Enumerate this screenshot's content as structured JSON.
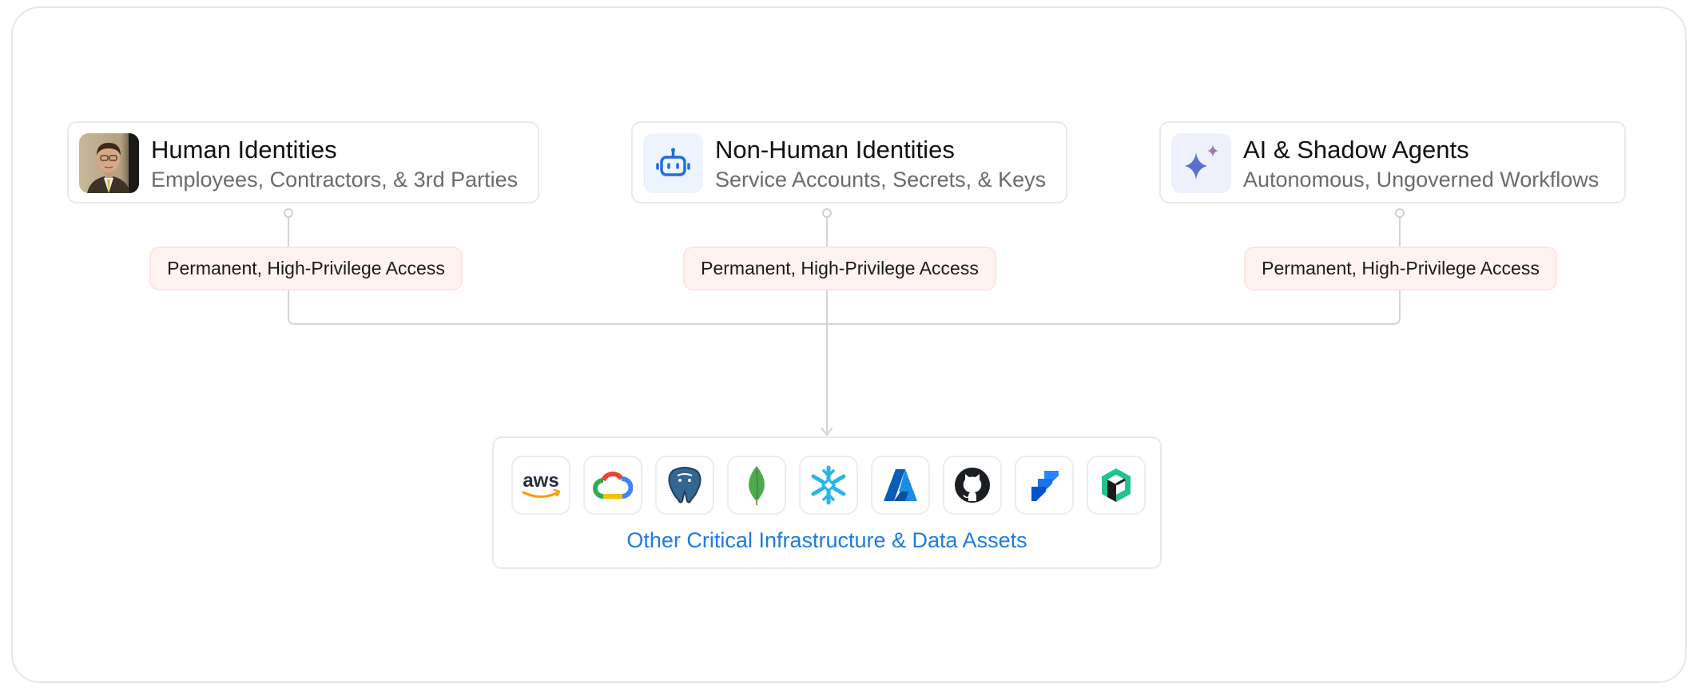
{
  "identities": [
    {
      "title": "Human Identities",
      "subtitle": "Employees, Contractors, & 3rd Parties",
      "icon": "person-photo-icon"
    },
    {
      "title": "Non-Human Identities",
      "subtitle": "Service Accounts, Secrets, & Keys",
      "icon": "robot-icon"
    },
    {
      "title": "AI & Shadow Agents",
      "subtitle": "Autonomous, Ungoverned Workflows",
      "icon": "sparkle-icon"
    }
  ],
  "access_labels": [
    "Permanent, High-Privilege Access",
    "Permanent, High-Privilege Access",
    "Permanent, High-Privilege Access"
  ],
  "assets": {
    "label": "Other Critical Infrastructure & Data Assets",
    "icons": [
      {
        "name": "aws-logo-icon",
        "text": "aws"
      },
      {
        "name": "google-cloud-logo-icon"
      },
      {
        "name": "postgresql-logo-icon"
      },
      {
        "name": "mongodb-logo-icon"
      },
      {
        "name": "snowflake-logo-icon"
      },
      {
        "name": "azure-logo-icon"
      },
      {
        "name": "github-logo-icon"
      },
      {
        "name": "jira-logo-icon"
      },
      {
        "name": "nutanix-logo-icon"
      }
    ]
  },
  "colors": {
    "accent_blue": "#1e7be0",
    "pill_bg": "#fff3f1",
    "connector": "#d4d4d4",
    "icon_bg": "#eef4fe"
  }
}
